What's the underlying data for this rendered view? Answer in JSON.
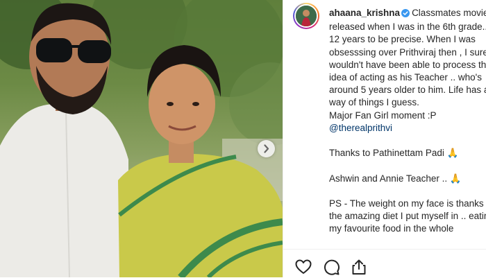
{
  "post": {
    "username": "ahaana_krishna",
    "caption_line1": "Classmates movie released when I was in the 6th grade.. 12 years to be precise. When I was obsesssing over Prithviraj then , I surely wouldn't have been able to process the idea of acting as his Teacher .. who's around 5 years older to him. Life has a way of things I guess.",
    "caption_line2": "Major Fan Girl moment :P",
    "mention": "@therealprithvi",
    "caption_line3": "Thanks to Pathinettam Padi 🙏",
    "caption_line4": "Ashwin and Annie Teacher .. 🙏",
    "caption_line5": "PS - The weight on my face is thanks to the amazing diet I put myself in .. eating my favourite food in the whole"
  },
  "icons": {
    "like": "heart-icon",
    "comment": "comment-icon",
    "share": "share-icon",
    "next": "chevron-right-icon",
    "verified": "verified-badge-icon"
  },
  "colors": {
    "verified": "#3897f0",
    "text": "#262626",
    "mention": "#003569",
    "saree": "#c9c94a",
    "saree_border": "#3d8a4c"
  }
}
